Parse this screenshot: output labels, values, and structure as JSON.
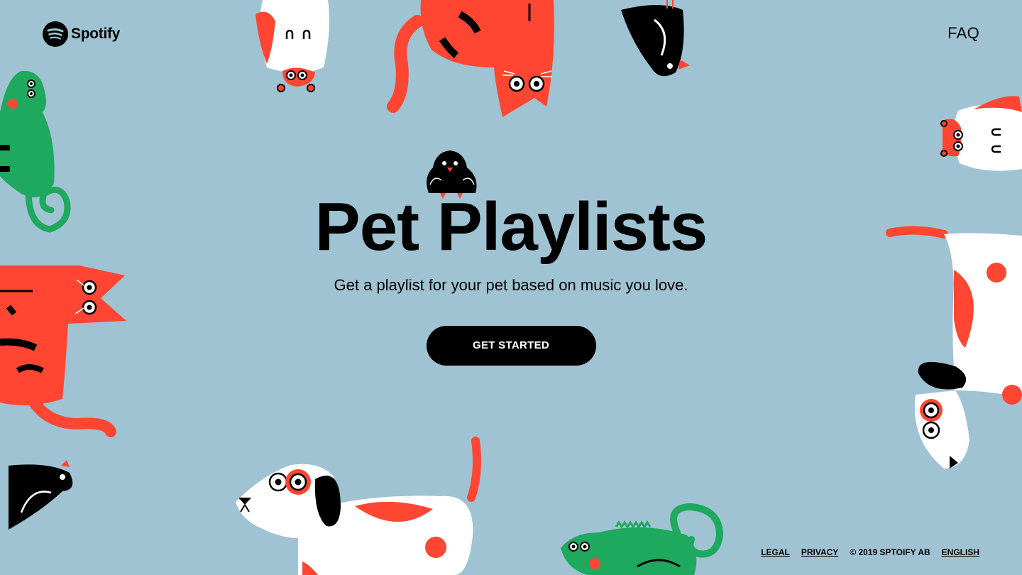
{
  "header": {
    "brand": "Spotify",
    "faq_label": "FAQ"
  },
  "hero": {
    "title": "Pet Playlists",
    "subtitle": "Get a playlist for your pet based on music you love.",
    "cta_label": "GET STARTED"
  },
  "footer": {
    "legal_label": "LEGAL",
    "privacy_label": "PRIVACY",
    "copyright": "© 2019 SPTOIFY AB",
    "language_label": "ENGLISH"
  },
  "illustrations": [
    "hamster-icon",
    "cat-icon",
    "bird-icon",
    "iguana-icon",
    "dog-icon"
  ],
  "colors": {
    "background": "#9fc3d2",
    "accent_red": "#ff4632",
    "accent_green": "#1ea95f",
    "button_bg": "#000000",
    "button_text": "#ffffff"
  }
}
